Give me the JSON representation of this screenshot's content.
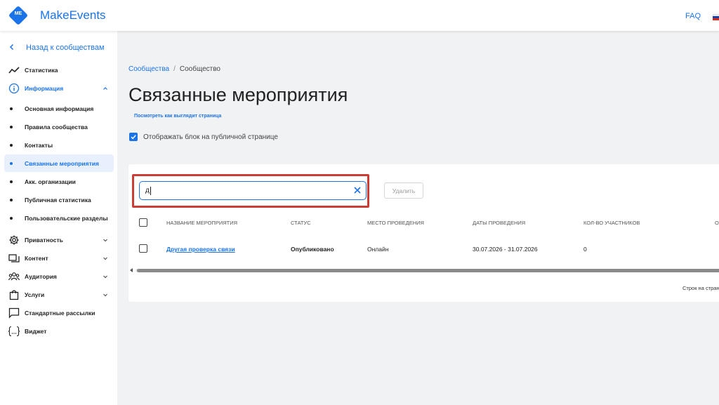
{
  "header": {
    "logo_text": "ME",
    "brand": "MakeEvents",
    "faq": "FAQ",
    "flag_icon": "russian-flag-icon"
  },
  "sidebar": {
    "back_label": "Назад к сообществам",
    "items": [
      {
        "label": "Статистика",
        "icon": "chart-line-icon"
      },
      {
        "label": "Информация",
        "icon": "info-icon",
        "expanded": true
      },
      {
        "label": "Приватность",
        "icon": "gear-icon"
      },
      {
        "label": "Контент",
        "icon": "folder-icon"
      },
      {
        "label": "Аудитория",
        "icon": "people-icon"
      },
      {
        "label": "Услуги",
        "icon": "bag-icon"
      },
      {
        "label": "Стандартные рассылки",
        "icon": "chat-icon"
      },
      {
        "label": "Виджет",
        "icon": "braces-icon"
      }
    ],
    "subitems": [
      {
        "label": "Основная информация"
      },
      {
        "label": "Правила сообщества"
      },
      {
        "label": "Контакты"
      },
      {
        "label": "Связанные мероприятия",
        "active": true
      },
      {
        "label": "Акк. организации"
      },
      {
        "label": "Публичная статистика"
      },
      {
        "label": "Пользовательские разделы"
      }
    ]
  },
  "breadcrumb": {
    "parent": "Сообщества",
    "separator": "/",
    "current": "Сообщество"
  },
  "page": {
    "title": "Связанные мероприятия",
    "preview_link": "Посмотреть как выглядит страница",
    "show_block_label": "Отображать блок на публичной странице",
    "show_block_checked": true
  },
  "search": {
    "value": "д"
  },
  "actions": {
    "delete_label": "Удалить"
  },
  "table": {
    "columns": [
      "Название мероприятия",
      "Статус",
      "Место проведения",
      "Даты проведения",
      "Кол-во участников",
      "О"
    ],
    "rows": [
      {
        "name": "Другая проверка связи",
        "status": "Опубликовано",
        "place": "Онлайн",
        "dates": "30.07.2026 - 31.07.2026",
        "participants": "0"
      }
    ],
    "rows_per_page_label": "Строк на стран"
  },
  "colors": {
    "accent": "#1a73e8",
    "highlight": "#cc3d36",
    "active_bg": "#e8f0fe"
  }
}
